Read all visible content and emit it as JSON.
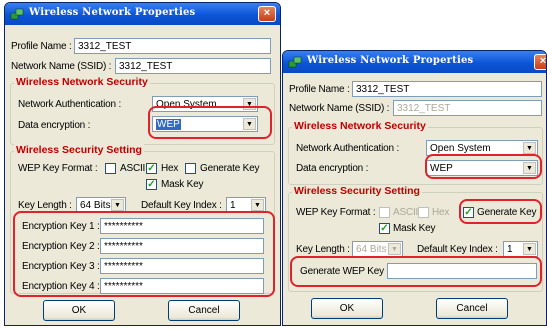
{
  "dialog1": {
    "title": "Wireless Network Properties",
    "close": "×",
    "profile_name_label": "Profile Name :",
    "profile_name_value": "3312_TEST",
    "ssid_label": "Network Name (SSID) :",
    "ssid_value": "3312_TEST",
    "security_group": "Wireless Network Security",
    "auth_label": "Network Authentication :",
    "auth_value": "Open System",
    "encryption_label": "Data encryption :",
    "encryption_value": "WEP",
    "setting_group": "Wireless Security Setting",
    "wep_format_label": "WEP Key Format :",
    "ascii_label": "ASCII",
    "ascii_checked": false,
    "hex_label": "Hex",
    "hex_checked": true,
    "generate_key_label": "Generate Key",
    "generate_key_checked": false,
    "mask_key_label": "Mask Key",
    "mask_key_checked": true,
    "key_length_label": "Key Length :",
    "key_length_value": "64 Bits",
    "default_key_index_label": "Default Key Index :",
    "default_key_index_value": "1",
    "keys": [
      {
        "label": "Encryption Key 1 :",
        "value": "**********"
      },
      {
        "label": "Encryption Key 2 :",
        "value": "**********"
      },
      {
        "label": "Encryption Key 3 :",
        "value": "**********"
      },
      {
        "label": "Encryption Key 4 :",
        "value": "**********"
      }
    ],
    "ok_label": "OK",
    "cancel_label": "Cancel"
  },
  "dialog2": {
    "title": "Wireless Network Properties",
    "close": "×",
    "profile_name_label": "Profile Name :",
    "profile_name_value": "3312_TEST",
    "ssid_label": "Network Name (SSID) :",
    "ssid_value": "3312_TEST",
    "security_group": "Wireless Network Security",
    "auth_label": "Network Authentication :",
    "auth_value": "Open System",
    "encryption_label": "Data encryption :",
    "encryption_value": "WEP",
    "setting_group": "Wireless Security Setting",
    "wep_format_label": "WEP Key Format :",
    "ascii_label": "ASCII",
    "ascii_checked": false,
    "hex_label": "Hex",
    "hex_checked": false,
    "generate_key_label": "Generate Key",
    "generate_key_checked": true,
    "mask_key_label": "Mask Key",
    "mask_key_checked": true,
    "key_length_label": "Key Length :",
    "key_length_value": "64 Bits",
    "default_key_index_label": "Default Key Index :",
    "default_key_index_value": "1",
    "generate_wep_key_label": "Generate WEP Key :",
    "generate_wep_key_value": "",
    "ok_label": "OK",
    "cancel_label": "Cancel"
  },
  "colors": {
    "titlebar": "#0b55d8",
    "group_title": "#c00000",
    "highlight": "#e0232b",
    "selection": "#316ac5"
  },
  "icons": {
    "title_icon": "wireless-network-icon",
    "close": "close-icon",
    "dropdown": "chevron-down-icon",
    "checkbox": "checkmark-icon"
  }
}
